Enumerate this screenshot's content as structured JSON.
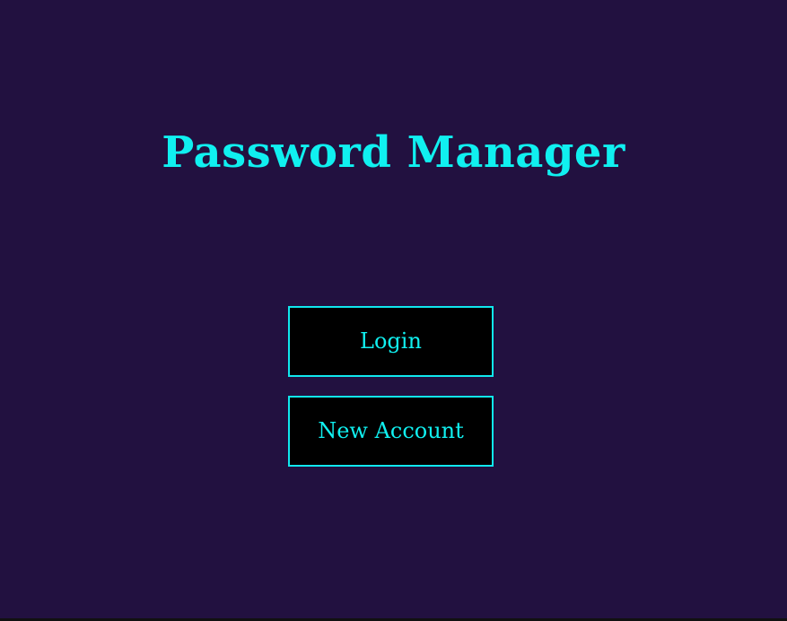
{
  "app": {
    "title": "Password Manager"
  },
  "actions": {
    "login_label": "Login",
    "new_account_label": "New Account"
  },
  "colors": {
    "background": "#221140",
    "accent": "#10F0F0",
    "button_background": "#000000"
  }
}
